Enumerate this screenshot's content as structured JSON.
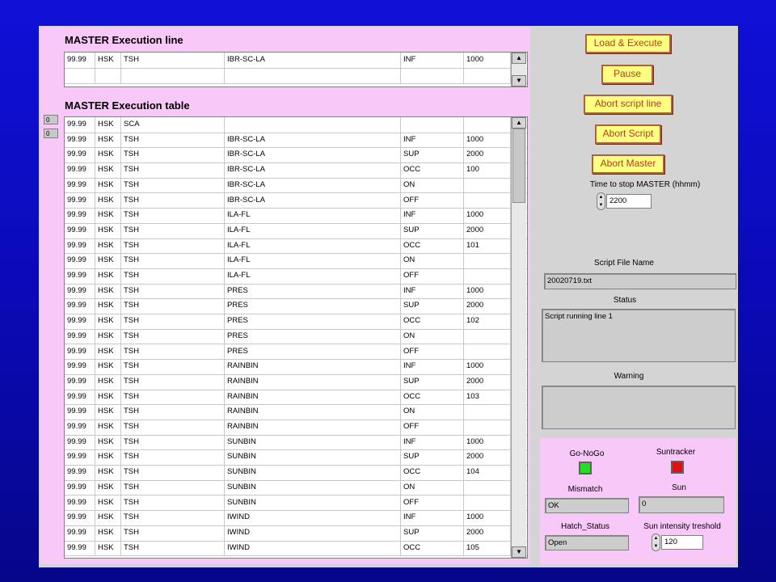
{
  "exec_line": {
    "title": "MASTER Execution line",
    "row": [
      "99.99",
      "HSK",
      "TSH",
      "IBR-SC-LA",
      "INF",
      "1000"
    ]
  },
  "exec_table": {
    "title": "MASTER Execution table",
    "index": [
      "0",
      "0"
    ],
    "rows": [
      [
        "99.99",
        "HSK",
        "SCA",
        "",
        "",
        ""
      ],
      [
        "99.99",
        "HSK",
        "TSH",
        "IBR-SC-LA",
        "INF",
        "1000"
      ],
      [
        "99.99",
        "HSK",
        "TSH",
        "IBR-SC-LA",
        "SUP",
        "2000"
      ],
      [
        "99.99",
        "HSK",
        "TSH",
        "IBR-SC-LA",
        "OCC",
        "100"
      ],
      [
        "99.99",
        "HSK",
        "TSH",
        "IBR-SC-LA",
        "ON",
        ""
      ],
      [
        "99.99",
        "HSK",
        "TSH",
        "IBR-SC-LA",
        "OFF",
        ""
      ],
      [
        "99.99",
        "HSK",
        "TSH",
        "ILA-FL",
        "INF",
        "1000"
      ],
      [
        "99.99",
        "HSK",
        "TSH",
        "ILA-FL",
        "SUP",
        "2000"
      ],
      [
        "99.99",
        "HSK",
        "TSH",
        "ILA-FL",
        "OCC",
        "101"
      ],
      [
        "99.99",
        "HSK",
        "TSH",
        "ILA-FL",
        "ON",
        ""
      ],
      [
        "99.99",
        "HSK",
        "TSH",
        "ILA-FL",
        "OFF",
        ""
      ],
      [
        "99.99",
        "HSK",
        "TSH",
        "PRES",
        "INF",
        "1000"
      ],
      [
        "99.99",
        "HSK",
        "TSH",
        "PRES",
        "SUP",
        "2000"
      ],
      [
        "99.99",
        "HSK",
        "TSH",
        "PRES",
        "OCC",
        "102"
      ],
      [
        "99.99",
        "HSK",
        "TSH",
        "PRES",
        "ON",
        ""
      ],
      [
        "99.99",
        "HSK",
        "TSH",
        "PRES",
        "OFF",
        ""
      ],
      [
        "99.99",
        "HSK",
        "TSH",
        "RAINBIN",
        "INF",
        "1000"
      ],
      [
        "99.99",
        "HSK",
        "TSH",
        "RAINBIN",
        "SUP",
        "2000"
      ],
      [
        "99.99",
        "HSK",
        "TSH",
        "RAINBIN",
        "OCC",
        "103"
      ],
      [
        "99.99",
        "HSK",
        "TSH",
        "RAINBIN",
        "ON",
        ""
      ],
      [
        "99.99",
        "HSK",
        "TSH",
        "RAINBIN",
        "OFF",
        ""
      ],
      [
        "99.99",
        "HSK",
        "TSH",
        "SUNBIN",
        "INF",
        "1000"
      ],
      [
        "99.99",
        "HSK",
        "TSH",
        "SUNBIN",
        "SUP",
        "2000"
      ],
      [
        "99.99",
        "HSK",
        "TSH",
        "SUNBIN",
        "OCC",
        "104"
      ],
      [
        "99.99",
        "HSK",
        "TSH",
        "SUNBIN",
        "ON",
        ""
      ],
      [
        "99.99",
        "HSK",
        "TSH",
        "SUNBIN",
        "OFF",
        ""
      ],
      [
        "99.99",
        "HSK",
        "TSH",
        "IWIND",
        "INF",
        "1000"
      ],
      [
        "99.99",
        "HSK",
        "TSH",
        "IWIND",
        "SUP",
        "2000"
      ],
      [
        "99.99",
        "HSK",
        "TSH",
        "IWIND",
        "OCC",
        "105"
      ]
    ]
  },
  "buttons": {
    "load_execute": "Load & Execute",
    "pause": "Pause",
    "abort_script_line": "Abort script line",
    "abort_script": "Abort Script",
    "abort_master": "Abort Master"
  },
  "stop_time": {
    "label": "Time to stop MASTER (hhmm)",
    "value": "2200"
  },
  "script_file": {
    "label": "Script File Name",
    "value": "20020719.txt"
  },
  "status": {
    "label": "Status",
    "value": "Script running line 1"
  },
  "warning": {
    "label": "Warning",
    "value": ""
  },
  "indicators": {
    "go_nogo": {
      "label": "Go-NoGo",
      "color": "#20e020"
    },
    "suntracker": {
      "label": "Suntracker",
      "color": "#e01010"
    },
    "mismatch": {
      "label": "Mismatch",
      "value": "OK"
    },
    "sun": {
      "label": "Sun",
      "value": "0"
    },
    "hatch": {
      "label": "Hatch_Status",
      "value": "Open"
    },
    "sun_threshold": {
      "label": "Sun intensity treshold",
      "value": "120"
    }
  }
}
